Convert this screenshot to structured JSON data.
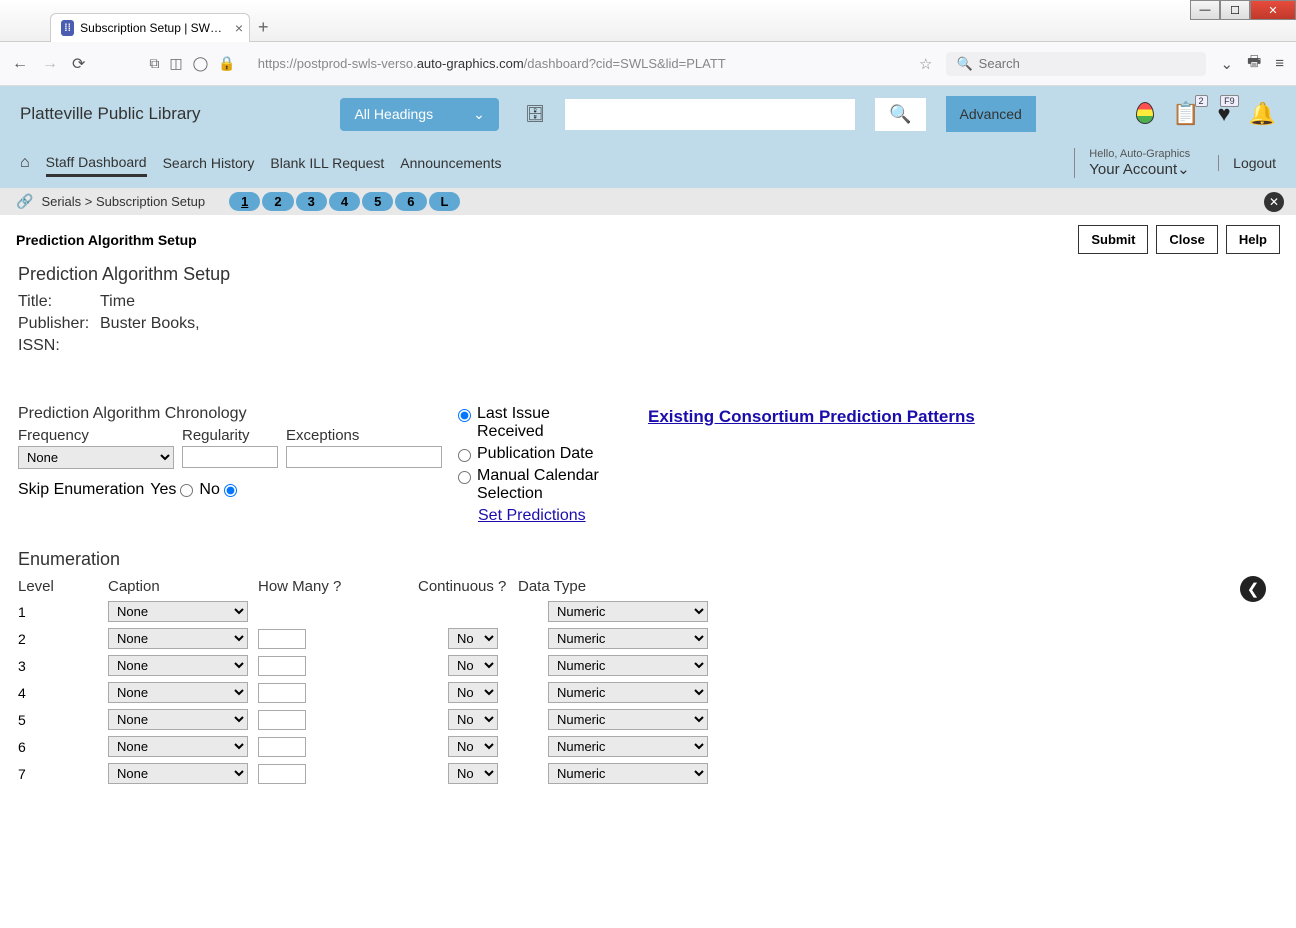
{
  "browser": {
    "tab_title": "Subscription Setup | SWLS | plat",
    "url_pre": "https://postprod-swls-verso.",
    "url_dark": "auto-graphics.com",
    "url_post": "/dashboard?cid=SWLS&lid=PLATT",
    "search_placeholder": "Search"
  },
  "header": {
    "library_name": "Platteville Public Library",
    "headings_label": "All Headings",
    "advanced_label": "Advanced",
    "list_badge": "2",
    "heart_badge": "F9",
    "hello_text": "Hello, Auto-Graphics",
    "account_label": "Your Account",
    "logout_label": "Logout"
  },
  "nav": {
    "items": [
      "Staff Dashboard",
      "Search History",
      "Blank ILL Request",
      "Announcements"
    ]
  },
  "crumb": {
    "path": "Serials  >  Subscription Setup",
    "pages": [
      "1",
      "2",
      "3",
      "4",
      "5",
      "6",
      "L"
    ]
  },
  "page": {
    "title": "Prediction Algorithm Setup",
    "submit": "Submit",
    "close": "Close",
    "help": "Help"
  },
  "setup": {
    "heading": "Prediction Algorithm Setup",
    "title_label": "Title:",
    "title_value": "Time",
    "publisher_label": "Publisher:",
    "publisher_value": "Buster Books,",
    "issn_label": "ISSN:",
    "issn_value": ""
  },
  "form": {
    "algo_label": "Prediction Algorithm Chronology",
    "frequency_label": "Frequency",
    "frequency_value": "None",
    "regularity_label": "Regularity",
    "exceptions_label": "Exceptions",
    "skip_label": "Skip Enumeration",
    "yes": "Yes",
    "no": "No",
    "chron_last_issue": "Last Issue Received",
    "chron_pub_date": "Publication Date",
    "chron_manual": "Manual Calendar Selection",
    "set_predictions": "Set Predictions",
    "existing_link": "Existing Consortium Prediction Patterns"
  },
  "enum": {
    "heading": "Enumeration",
    "headers": {
      "level": "Level",
      "caption": "Caption",
      "howmany": "How Many ?",
      "continuous": "Continuous ?",
      "datatype": "Data Type"
    },
    "caption_default": "None",
    "cont_default": "No",
    "datatype_default": "Numeric",
    "rows": [
      {
        "level": "1",
        "show_howmany": false,
        "show_cont": false
      },
      {
        "level": "2",
        "show_howmany": true,
        "show_cont": true
      },
      {
        "level": "3",
        "show_howmany": true,
        "show_cont": true
      },
      {
        "level": "4",
        "show_howmany": true,
        "show_cont": true
      },
      {
        "level": "5",
        "show_howmany": true,
        "show_cont": true
      },
      {
        "level": "6",
        "show_howmany": true,
        "show_cont": true
      },
      {
        "level": "7",
        "show_howmany": true,
        "show_cont": true
      }
    ]
  }
}
